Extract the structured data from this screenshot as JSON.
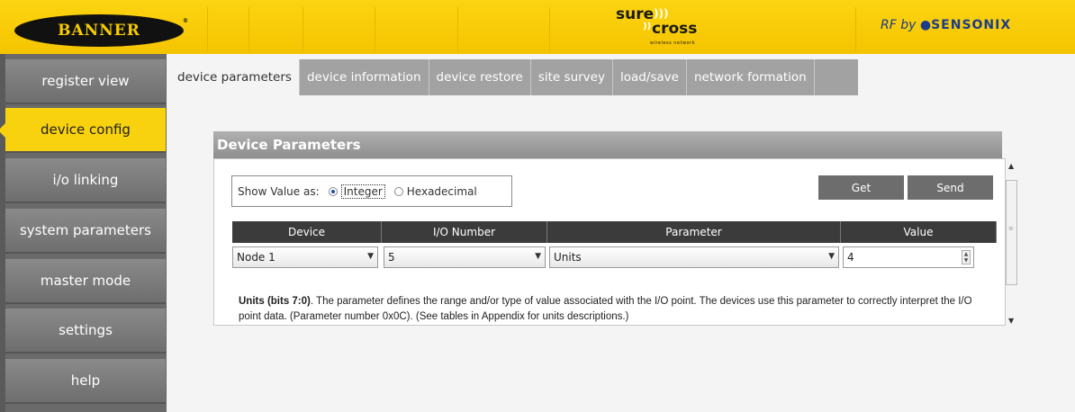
{
  "header": {
    "brand_logo": "BANNER",
    "brand_reg": "®",
    "product_sure": "sure",
    "product_cross": "cross",
    "product_tagline": "wireless network",
    "rf_by": "RF by",
    "partner": "SENSONIX"
  },
  "sidebar": {
    "items": [
      {
        "label": "register view"
      },
      {
        "label": "device config"
      },
      {
        "label": "i/o linking"
      },
      {
        "label": "system parameters"
      },
      {
        "label": "master mode"
      },
      {
        "label": "settings"
      },
      {
        "label": "help"
      }
    ],
    "active_index": 1
  },
  "tabs": [
    {
      "label": "device parameters"
    },
    {
      "label": "device information"
    },
    {
      "label": "device restore"
    },
    {
      "label": "site survey"
    },
    {
      "label": "load/save"
    },
    {
      "label": "network formation"
    }
  ],
  "panel": {
    "title": "Device Parameters",
    "show_value_label": "Show Value as:",
    "option_integer": "Integer",
    "option_hex": "Hexadecimal",
    "selected_option": "Integer",
    "get_label": "Get",
    "send_label": "Send",
    "columns": [
      "Device",
      "I/O Number",
      "Parameter",
      "Value"
    ],
    "row": {
      "device": "Node 1",
      "io_number": "5",
      "parameter": "Units",
      "value": "4"
    },
    "desc_bold": "Units (bits 7:0)",
    "desc_text": ". The parameter defines the range and/or type of value associated with the I/O point. The devices use this parameter to correctly interpret the I/O point data. (Parameter number 0x0C). (See tables in Appendix for units descriptions.)"
  },
  "colors": {
    "header_yellow": "#f5c400",
    "sidebar_gray": "#7a7a7a",
    "active_yellow": "#f8d10f",
    "table_header": "#3b3b3b"
  }
}
